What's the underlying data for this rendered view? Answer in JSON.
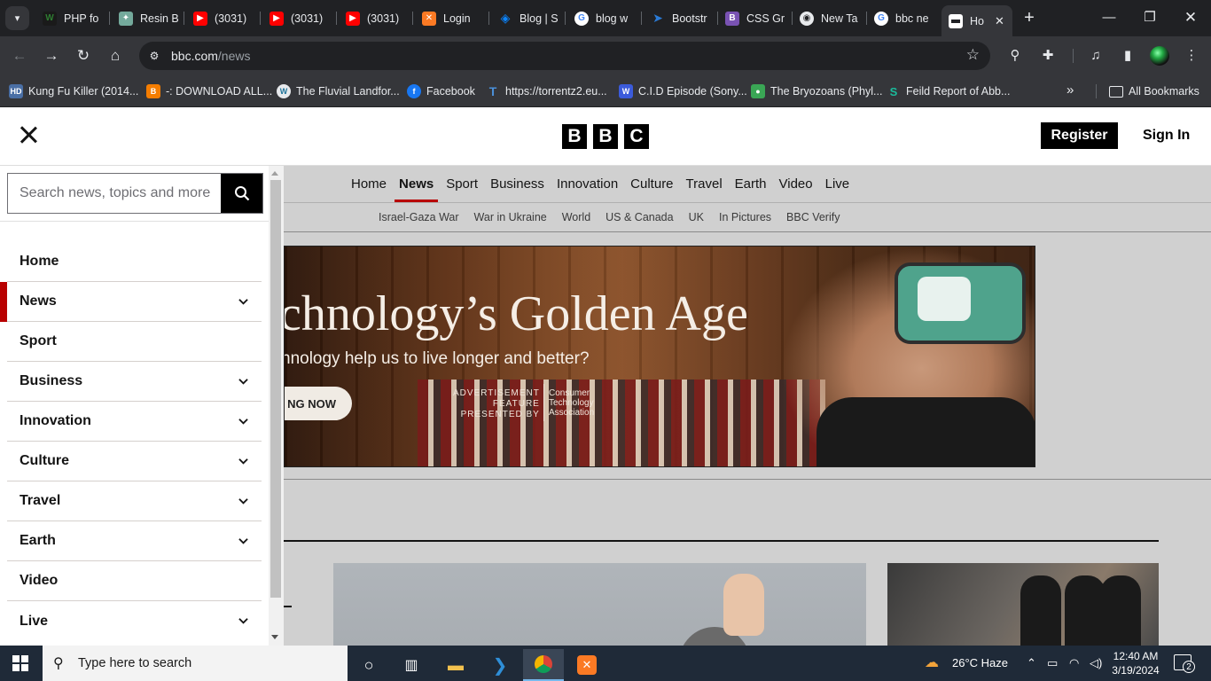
{
  "browser": {
    "tabs": [
      {
        "title": "PHP fo",
        "icon": "w-icon",
        "color": "#2e7d32"
      },
      {
        "title": "Resin B",
        "icon": "chatgpt-icon",
        "color": "#74aa9c"
      },
      {
        "title": "(3031)",
        "icon": "youtube-icon",
        "color": "#ff0000"
      },
      {
        "title": "(3031)",
        "icon": "youtube-icon",
        "color": "#ff0000"
      },
      {
        "title": "(3031)",
        "icon": "youtube-icon",
        "color": "#ff0000"
      },
      {
        "title": "Login",
        "icon": "xampp-icon",
        "color": "#fb7a24"
      },
      {
        "title": "Blog | S",
        "icon": "drop-icon",
        "color": "#0a84ff"
      },
      {
        "title": "blog w",
        "icon": "google-icon",
        "color": "#ffffff"
      },
      {
        "title": "Bootstr",
        "icon": "bootstrap-icon",
        "color": "#2a7bd6"
      },
      {
        "title": "CSS Gr",
        "icon": "b-icon",
        "color": "#7952b3"
      },
      {
        "title": "New Ta",
        "icon": "chrome-icon",
        "color": "#ffffff"
      },
      {
        "title": "bbc ne",
        "icon": "google-icon",
        "color": "#ffffff"
      }
    ],
    "active_tab": {
      "title": "Ho",
      "icon": "bbc-icon"
    },
    "url_host": "bbc.com",
    "url_path": "/news",
    "bookmarks": [
      {
        "title": "Kung Fu Killer (2014...",
        "icon": "hd-icon",
        "color": "#4a6fa5"
      },
      {
        "title": "-: DOWNLOAD ALL...",
        "icon": "blogger-icon",
        "color": "#f57d00"
      },
      {
        "title": "The Fluvial Landfor...",
        "icon": "wordpress-icon",
        "color": "#e8eaed"
      },
      {
        "title": "Facebook",
        "icon": "facebook-icon",
        "color": "#1877f2"
      },
      {
        "title": "https://torrentz2.eu...",
        "icon": "t-icon",
        "color": "#4a90d9"
      },
      {
        "title": "C.I.D Episode (Sony...",
        "icon": "w-icon",
        "color": "#3b5bdb"
      },
      {
        "title": "The Bryozoans (Phyl...",
        "icon": "globe-icon",
        "color": "#3aa655"
      },
      {
        "title": "Feild Report of Abb...",
        "icon": "s-icon",
        "color": "#1abc9c"
      }
    ],
    "all_bookmarks": "All Bookmarks"
  },
  "bbc": {
    "logo": [
      "B",
      "B",
      "C"
    ],
    "register": "Register",
    "sign_in": "Sign In",
    "nav_main": [
      "Home",
      "News",
      "Sport",
      "Business",
      "Innovation",
      "Culture",
      "Travel",
      "Earth",
      "Video",
      "Live"
    ],
    "nav_main_active": "News",
    "nav_sub": [
      "Israel-Gaza War",
      "War in Ukraine",
      "World",
      "US & Canada",
      "UK",
      "In Pictures",
      "BBC Verify"
    ],
    "search_placeholder": "Search news, topics and more",
    "menu": [
      {
        "label": "Home",
        "expandable": false
      },
      {
        "label": "News",
        "expandable": true,
        "active": true
      },
      {
        "label": "Sport",
        "expandable": false
      },
      {
        "label": "Business",
        "expandable": true
      },
      {
        "label": "Innovation",
        "expandable": true
      },
      {
        "label": "Culture",
        "expandable": true
      },
      {
        "label": "Travel",
        "expandable": true
      },
      {
        "label": "Earth",
        "expandable": true
      },
      {
        "label": "Video",
        "expandable": false
      },
      {
        "label": "Live",
        "expandable": true
      }
    ],
    "ad": {
      "title": "chnology’s Golden Age",
      "subtitle": "nnology help us to live longer and better?",
      "cta": "NG NOW",
      "feature_line1": "ADVERTISEMENT",
      "feature_line2": "FEATURE",
      "feature_line3": "PRESENTED BY",
      "sponsor_line1": "Consumer",
      "sponsor_line2": "Technology",
      "sponsor_line3": "Association"
    }
  },
  "taskbar": {
    "search_placeholder": "Type here to search",
    "weather": "26°C  Haze",
    "time": "12:40 AM",
    "date": "3/19/2024",
    "notifications": "2"
  },
  "colors": {
    "bbc_red": "#b80000",
    "chrome_dark": "#202124",
    "chrome_toolbar": "#35363a",
    "taskbar": "#1f2a38"
  }
}
